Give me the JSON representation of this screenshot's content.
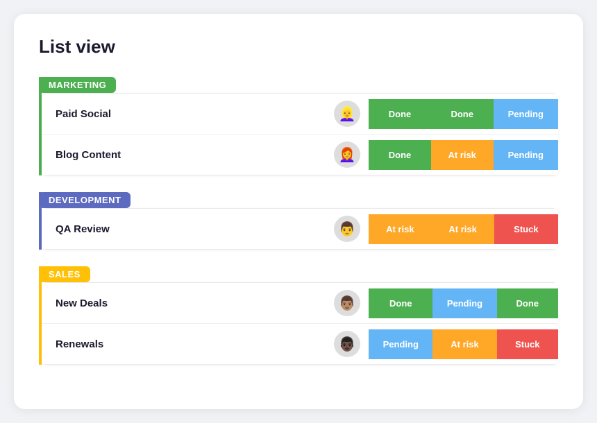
{
  "page": {
    "title": "List view"
  },
  "groups": [
    {
      "id": "marketing",
      "label": "MARKETING",
      "color_class": "group-marketing",
      "header_class": "group-header-marketing",
      "rows": [
        {
          "name": "Paid Social",
          "avatar_emoji": "👱‍♀️",
          "statuses": [
            {
              "label": "Done",
              "class": "badge-done"
            },
            {
              "label": "Done",
              "class": "badge-done"
            },
            {
              "label": "Pending",
              "class": "badge-pending"
            }
          ]
        },
        {
          "name": "Blog Content",
          "avatar_emoji": "👩‍🦰",
          "statuses": [
            {
              "label": "Done",
              "class": "badge-done"
            },
            {
              "label": "At risk",
              "class": "badge-at-risk"
            },
            {
              "label": "Pending",
              "class": "badge-pending"
            }
          ]
        }
      ]
    },
    {
      "id": "development",
      "label": "DEVELOPMENT",
      "color_class": "group-development",
      "header_class": "group-header-development",
      "rows": [
        {
          "name": "QA Review",
          "avatar_emoji": "👨",
          "statuses": [
            {
              "label": "At risk",
              "class": "badge-at-risk"
            },
            {
              "label": "At risk",
              "class": "badge-at-risk"
            },
            {
              "label": "Stuck",
              "class": "badge-stuck"
            }
          ]
        }
      ]
    },
    {
      "id": "sales",
      "label": "SALES",
      "color_class": "group-sales",
      "header_class": "group-header-sales",
      "rows": [
        {
          "name": "New Deals",
          "avatar_emoji": "👨🏽",
          "statuses": [
            {
              "label": "Done",
              "class": "badge-done"
            },
            {
              "label": "Pending",
              "class": "badge-pending"
            },
            {
              "label": "Done",
              "class": "badge-done"
            }
          ]
        },
        {
          "name": "Renewals",
          "avatar_emoji": "👨🏿",
          "statuses": [
            {
              "label": "Pending",
              "class": "badge-pending"
            },
            {
              "label": "At risk",
              "class": "badge-at-risk"
            },
            {
              "label": "Stuck",
              "class": "badge-stuck"
            }
          ]
        }
      ]
    }
  ]
}
